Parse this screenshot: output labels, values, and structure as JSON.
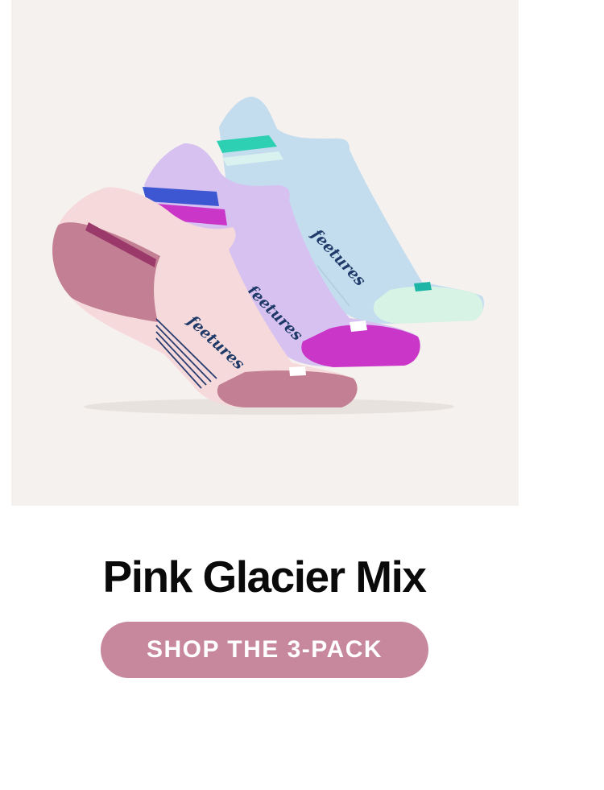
{
  "product": {
    "brand_logo_text": "feetures",
    "title": "Pink Glacier Mix",
    "cta_label": "SHOP THE 3-PACK"
  },
  "colors": {
    "background": "#ffffff",
    "hero_background": "#f5f1ee",
    "cta_background": "#c7889d",
    "cta_text": "#ffffff",
    "title_text": "#0a0a0a",
    "sock_pink": "#f6dadb",
    "sock_pink_accent": "#c37f93",
    "sock_lavender": "#d6c1f0",
    "sock_lavender_accent": "#c936c8",
    "sock_blue": "#c3dcee",
    "sock_blue_accent": "#d6f3e5",
    "logo_navy": "#1f3a68"
  }
}
